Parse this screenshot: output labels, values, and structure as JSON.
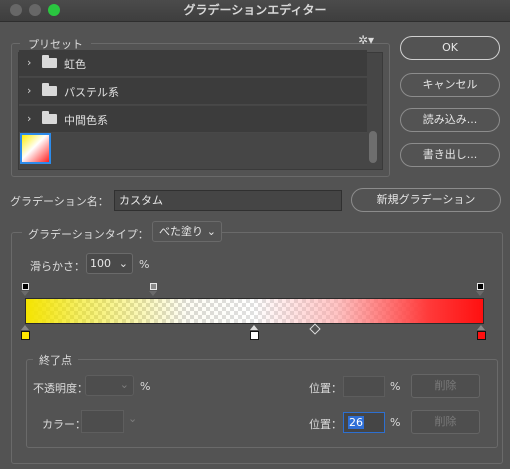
{
  "window": {
    "title": "グラデーションエディター"
  },
  "presets": {
    "label": "プリセット",
    "gear_icon": "gear-icon",
    "folders": [
      "虹色",
      "パステル系",
      "中間色系"
    ],
    "selected_swatch_colors": [
      "#ffef00",
      "#ffffff",
      "#ff2020"
    ]
  },
  "buttons": {
    "ok": "OK",
    "cancel": "キャンセル",
    "load": "読み込み...",
    "save": "書き出し...",
    "new_gradient": "新規グラデーション"
  },
  "name_field": {
    "label": "グラデーション名：",
    "value": "カスタム"
  },
  "type": {
    "label": "グラデーションタイプ：",
    "value": "べた塗り"
  },
  "smoothness": {
    "label": "滑らかさ：",
    "value": "100",
    "unit": "%"
  },
  "gradient": {
    "colors": [
      "#f5e400",
      "#ffffff",
      "#ff1010"
    ],
    "opacity_stops_count": 3,
    "color_stops": [
      {
        "color": "#ffe600",
        "location_percent": 0
      },
      {
        "color": "#ffffff",
        "location_percent": 50,
        "selected": true
      },
      {
        "color": "#ff1010",
        "location_percent": 100
      }
    ]
  },
  "stops": {
    "label": "終了点",
    "opacity_label": "不透明度：",
    "opacity_unit": "%",
    "opacity_location_label": "位置：",
    "opacity_location_unit": "%",
    "opacity_delete": "削除",
    "color_label": "カラー：",
    "color_location_label": "位置：",
    "color_location_value": "26",
    "color_location_unit": "%",
    "color_delete": "削除"
  }
}
